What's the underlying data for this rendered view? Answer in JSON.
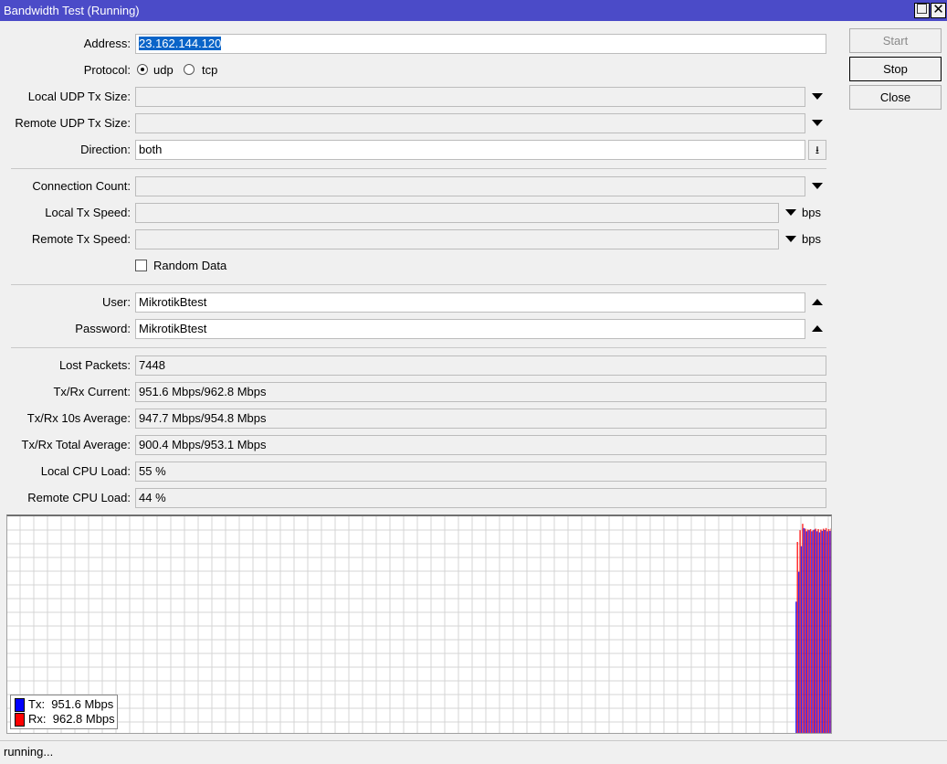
{
  "window": {
    "title": "Bandwidth Test (Running)",
    "maximize_icon": "maximize-icon",
    "close_icon": "close-icon"
  },
  "buttons": {
    "start": "Start",
    "stop": "Stop",
    "close": "Close"
  },
  "form": {
    "address": {
      "label": "Address:",
      "value": "23.162.144.120"
    },
    "protocol": {
      "label": "Protocol:",
      "options": [
        "udp",
        "tcp"
      ],
      "selected": "udp"
    },
    "local_udp_tx_size": {
      "label": "Local UDP Tx Size:",
      "value": ""
    },
    "remote_udp_tx_size": {
      "label": "Remote UDP Tx Size:",
      "value": ""
    },
    "direction": {
      "label": "Direction:",
      "value": "both"
    },
    "connection_count": {
      "label": "Connection Count:",
      "value": ""
    },
    "local_tx_speed": {
      "label": "Local Tx Speed:",
      "value": "",
      "unit": "bps"
    },
    "remote_tx_speed": {
      "label": "Remote Tx Speed:",
      "value": "",
      "unit": "bps"
    },
    "random_data": {
      "label": "Random Data",
      "checked": false
    },
    "user": {
      "label": "User:",
      "value": "MikrotikBtest"
    },
    "password": {
      "label": "Password:",
      "value": "MikrotikBtest"
    }
  },
  "stats": [
    {
      "label": "Lost Packets:",
      "value": "7448"
    },
    {
      "label": "Tx/Rx Current:",
      "value": "951.6 Mbps/962.8 Mbps"
    },
    {
      "label": "Tx/Rx 10s Average:",
      "value": "947.7 Mbps/954.8 Mbps"
    },
    {
      "label": "Tx/Rx Total Average:",
      "value": "900.4 Mbps/953.1 Mbps"
    },
    {
      "label": "Local CPU Load:",
      "value": "55 %"
    },
    {
      "label": "Remote CPU Load:",
      "value": "44 %"
    }
  ],
  "chart_data": {
    "type": "bar",
    "grid": true,
    "ylim": [
      0,
      1000
    ],
    "colors": {
      "tx": "#0000ff",
      "rx": "#ff0000"
    },
    "series": [
      {
        "name": "Tx",
        "values": [
          620,
          760,
          880,
          965,
          950,
          955,
          950,
          958,
          950,
          945,
          952,
          956,
          950,
          951.6
        ]
      },
      {
        "name": "Rx",
        "values": [
          900,
          955,
          985,
          962,
          958,
          960,
          955,
          962,
          960,
          958,
          962,
          965,
          960,
          962.8
        ]
      }
    ],
    "legend": [
      {
        "label": "Tx:",
        "value": "951.6 Mbps"
      },
      {
        "label": "Rx:",
        "value": "962.8 Mbps"
      }
    ],
    "legend_position": "bottom-left"
  },
  "status": "running..."
}
